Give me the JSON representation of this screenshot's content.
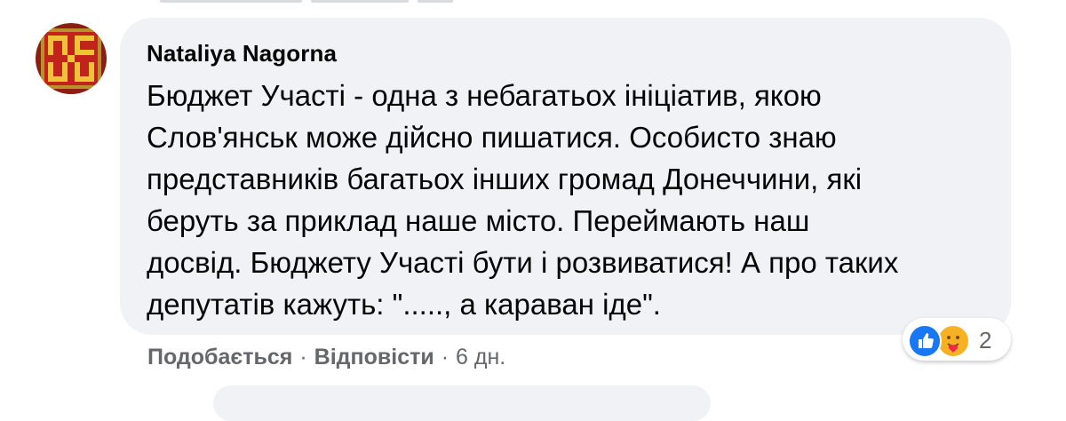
{
  "comment": {
    "author": "Nataliya Nagorna",
    "text_lines": [
      "Бюджет Участі - одна з небагатьох ініціатив, якою",
      "Слов'янськ може дійсно пишатися. Особисто знаю",
      "представників багатьох інших громад Донеччини, які",
      "беруть за приклад наше місто. Переймають наш",
      "досвід. Бюджету Участі бути і розвиватися! А про таких",
      "депутатів кажуть: \".....,  а караван іде\"."
    ],
    "avatar_icon": "embroidered-pattern-avatar",
    "reactions": {
      "icons": [
        "like-icon",
        "care-icon"
      ],
      "count": "2",
      "colors": {
        "like": "#1877f2",
        "care": "#f7b125"
      }
    },
    "actions": {
      "like_label": "Подобається",
      "separator": "·",
      "reply_label": "Відповісти",
      "time": "6 дн."
    }
  },
  "colors": {
    "bubble": "#f0f2f5",
    "text": "#050505",
    "secondary": "#65676b"
  }
}
